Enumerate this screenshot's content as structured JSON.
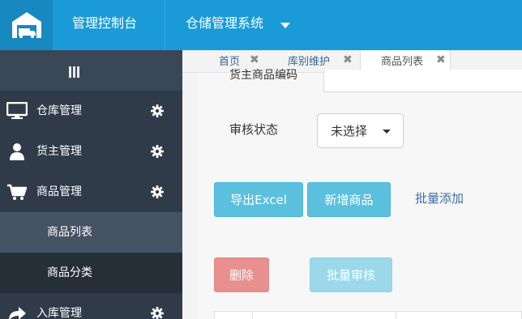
{
  "header": {
    "title": "管理控制台",
    "system": "仓储管理系统",
    "logo_icon": "warehouse-truck-icon"
  },
  "sidebar": {
    "collapse_icon": "menu-bars-icon",
    "items": [
      {
        "label": "仓库管理",
        "icon": "monitor-icon"
      },
      {
        "label": "货主管理",
        "icon": "user-icon"
      },
      {
        "label": "商品管理",
        "icon": "cart-icon"
      },
      {
        "label": "入库管理",
        "icon": "share-arrow-icon"
      }
    ],
    "submenu": [
      {
        "label": "商品列表",
        "active": true
      },
      {
        "label": "商品分类",
        "active": false
      }
    ]
  },
  "tabs": [
    {
      "label": "首页",
      "close": "✖"
    },
    {
      "label": "库别维护",
      "close": "✖"
    },
    {
      "label": "商品列表",
      "close": "✖",
      "active": true
    }
  ],
  "form": {
    "owner_code_label": "货主商品编码",
    "audit_label": "审核状态",
    "audit_value": "未选择"
  },
  "actions": {
    "export": "导出Excel",
    "add": "新增商品",
    "batch_add": "批量添加",
    "delete": "删除",
    "batch_audit": "批量审核"
  },
  "colors": {
    "topbar": "#1a9bd7",
    "sidebar": "#2f3b48",
    "info": "#5bc0de",
    "danger": "#e8908d",
    "link": "#3a6fa8"
  }
}
